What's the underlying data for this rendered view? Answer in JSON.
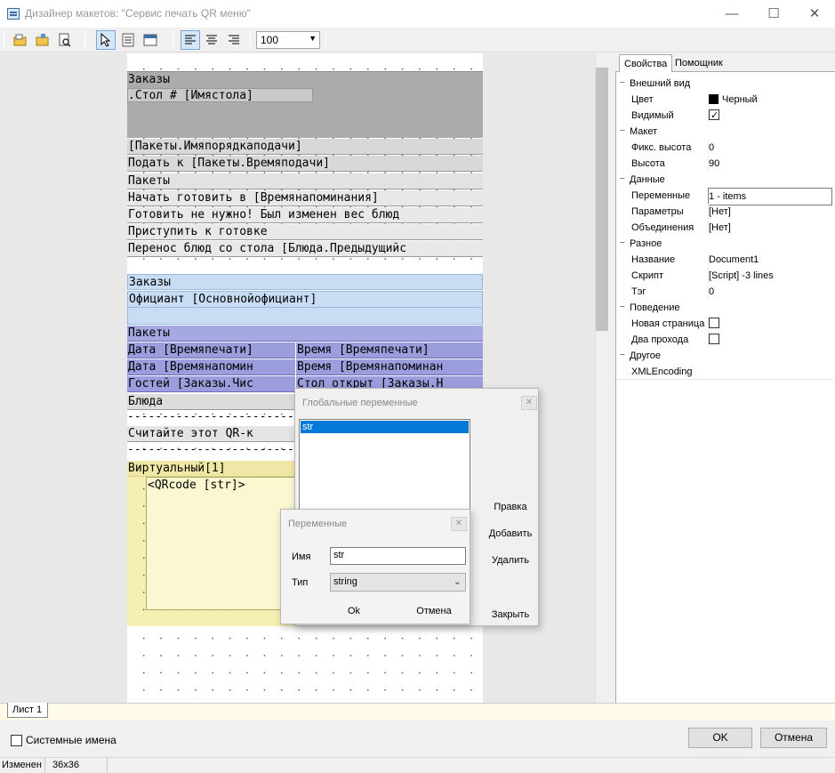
{
  "window": {
    "title": "Дизайнер макетов: \"Сервис печать QR меню\"",
    "min_glyph": "—",
    "max_glyph": "☐",
    "close_glyph": "✕"
  },
  "toolbar": {
    "zoom_value": "100",
    "icons": [
      "open-icon",
      "save-icon",
      "preview-icon",
      "pointer-icon",
      "text-object-icon",
      "band-icon",
      "align-left-icon",
      "align-center-icon",
      "align-right-icon"
    ]
  },
  "report": {
    "band_orders_header": "Заказы",
    "table_line": ".Стол # [Имястола]",
    "packages_order_line": "[Пакеты.Имяпорядкаподачи]",
    "serve_line": "Подать к [Пакеты.Времяподачи]",
    "packages_header": "Пакеты",
    "lines_gray": [
      "Начать готовить в [Времянапоминания]",
      "Готовить не нужно! Был изменен вес блюд",
      "Приступить к готовке",
      "Перенос блюд со стола [Блюда.Предыдущийс"
    ],
    "orders_blue_header": "Заказы",
    "waiter_line": "Официант [Основнойофициант]",
    "packages_violet_header": "Пакеты",
    "violet_rows": [
      [
        "Дата [Времяпечати]",
        "Время [Времяпечати]"
      ],
      [
        "Дата [Времянапомин",
        "Время [Времянапоминан"
      ],
      [
        "Гостей [Заказы.Чис",
        "Стол открыт [Заказы.Н"
      ]
    ],
    "dishes_header": "Блюда",
    "dash_line": "-----------------------------------------------",
    "scan_line": " Считайте этот QR-к",
    "virtual_header": "Виртуальный[1]",
    "qr_text": "<QRcode [str]>"
  },
  "properties": {
    "tab_props": "Свойства",
    "tab_helper": "Помощник",
    "rows": [
      {
        "type": "cat",
        "key": "Внешний вид"
      },
      {
        "type": "row",
        "key": "Цвет",
        "val": "Черный",
        "swatch": "#000000"
      },
      {
        "type": "row",
        "key": "Видимый",
        "check": true
      },
      {
        "type": "cat",
        "key": "Макет"
      },
      {
        "type": "row",
        "key": "Фикс. высота",
        "val": "0"
      },
      {
        "type": "row",
        "key": "Высота",
        "val": "90"
      },
      {
        "type": "cat",
        "key": "Данные"
      },
      {
        "type": "row",
        "key": "Переменные",
        "val": "1 - items",
        "highlight": true
      },
      {
        "type": "row",
        "key": "Параметры",
        "val": "[Нет]"
      },
      {
        "type": "row",
        "key": "Объединения",
        "val": "[Нет]"
      },
      {
        "type": "cat",
        "key": "Разное"
      },
      {
        "type": "row",
        "key": "Название",
        "val": "Document1"
      },
      {
        "type": "row",
        "key": "Скрипт",
        "val": "[Script] -3 lines"
      },
      {
        "type": "row",
        "key": "Тэг",
        "val": "0"
      },
      {
        "type": "cat",
        "key": "Поведение"
      },
      {
        "type": "row",
        "key": "Новая страница",
        "check": false
      },
      {
        "type": "row",
        "key": "Два прохода",
        "check": false
      },
      {
        "type": "cat",
        "key": "Другое"
      },
      {
        "type": "row",
        "key": "XMLEncoding",
        "val": ""
      }
    ]
  },
  "bottom": {
    "sheet_tab": "Лист 1",
    "system_names_label": "Системные имена",
    "ok_label": "OK",
    "cancel_label": "Отмена",
    "status_changed": "Изменен",
    "status_size": "36x36"
  },
  "global_vars_dialog": {
    "title": "Глобальные переменные",
    "list_items": [
      "str"
    ],
    "edit_label": "Правка",
    "add_label": "Добавить",
    "delete_label": "Удалить",
    "close_label": "Закрыть",
    "close_glyph": "✕"
  },
  "var_dialog": {
    "title": "Переменные",
    "name_label": "Имя",
    "name_value": "str",
    "type_label": "Тип",
    "type_value": "string",
    "ok_label": "Ok",
    "cancel_label": "Отмена",
    "close_glyph": "✕"
  }
}
